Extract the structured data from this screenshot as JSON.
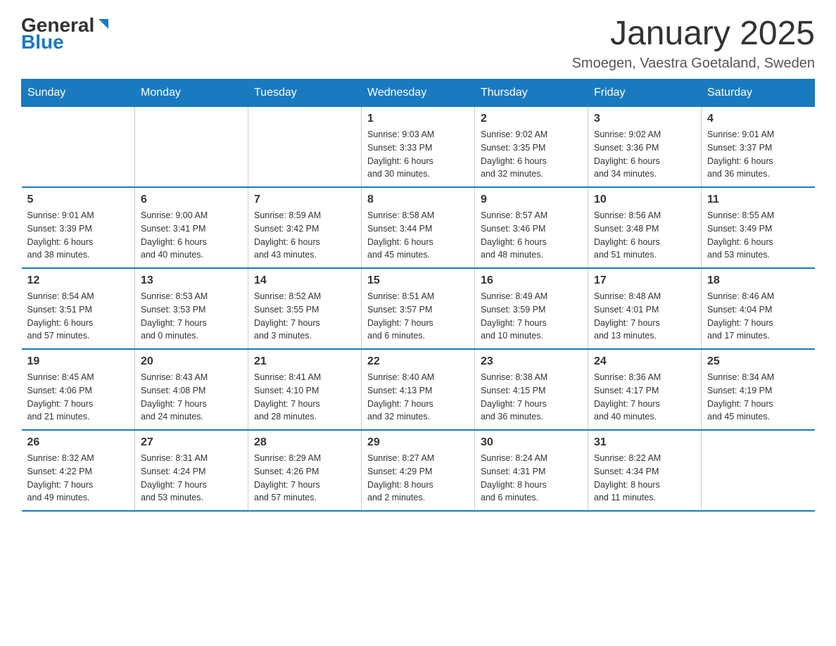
{
  "header": {
    "logo_general": "General",
    "logo_blue": "Blue",
    "month_title": "January 2025",
    "location": "Smoegen, Vaestra Goetaland, Sweden"
  },
  "weekdays": [
    "Sunday",
    "Monday",
    "Tuesday",
    "Wednesday",
    "Thursday",
    "Friday",
    "Saturday"
  ],
  "weeks": [
    [
      {
        "day": "",
        "info": ""
      },
      {
        "day": "",
        "info": ""
      },
      {
        "day": "",
        "info": ""
      },
      {
        "day": "1",
        "info": "Sunrise: 9:03 AM\nSunset: 3:33 PM\nDaylight: 6 hours\nand 30 minutes."
      },
      {
        "day": "2",
        "info": "Sunrise: 9:02 AM\nSunset: 3:35 PM\nDaylight: 6 hours\nand 32 minutes."
      },
      {
        "day": "3",
        "info": "Sunrise: 9:02 AM\nSunset: 3:36 PM\nDaylight: 6 hours\nand 34 minutes."
      },
      {
        "day": "4",
        "info": "Sunrise: 9:01 AM\nSunset: 3:37 PM\nDaylight: 6 hours\nand 36 minutes."
      }
    ],
    [
      {
        "day": "5",
        "info": "Sunrise: 9:01 AM\nSunset: 3:39 PM\nDaylight: 6 hours\nand 38 minutes."
      },
      {
        "day": "6",
        "info": "Sunrise: 9:00 AM\nSunset: 3:41 PM\nDaylight: 6 hours\nand 40 minutes."
      },
      {
        "day": "7",
        "info": "Sunrise: 8:59 AM\nSunset: 3:42 PM\nDaylight: 6 hours\nand 43 minutes."
      },
      {
        "day": "8",
        "info": "Sunrise: 8:58 AM\nSunset: 3:44 PM\nDaylight: 6 hours\nand 45 minutes."
      },
      {
        "day": "9",
        "info": "Sunrise: 8:57 AM\nSunset: 3:46 PM\nDaylight: 6 hours\nand 48 minutes."
      },
      {
        "day": "10",
        "info": "Sunrise: 8:56 AM\nSunset: 3:48 PM\nDaylight: 6 hours\nand 51 minutes."
      },
      {
        "day": "11",
        "info": "Sunrise: 8:55 AM\nSunset: 3:49 PM\nDaylight: 6 hours\nand 53 minutes."
      }
    ],
    [
      {
        "day": "12",
        "info": "Sunrise: 8:54 AM\nSunset: 3:51 PM\nDaylight: 6 hours\nand 57 minutes."
      },
      {
        "day": "13",
        "info": "Sunrise: 8:53 AM\nSunset: 3:53 PM\nDaylight: 7 hours\nand 0 minutes."
      },
      {
        "day": "14",
        "info": "Sunrise: 8:52 AM\nSunset: 3:55 PM\nDaylight: 7 hours\nand 3 minutes."
      },
      {
        "day": "15",
        "info": "Sunrise: 8:51 AM\nSunset: 3:57 PM\nDaylight: 7 hours\nand 6 minutes."
      },
      {
        "day": "16",
        "info": "Sunrise: 8:49 AM\nSunset: 3:59 PM\nDaylight: 7 hours\nand 10 minutes."
      },
      {
        "day": "17",
        "info": "Sunrise: 8:48 AM\nSunset: 4:01 PM\nDaylight: 7 hours\nand 13 minutes."
      },
      {
        "day": "18",
        "info": "Sunrise: 8:46 AM\nSunset: 4:04 PM\nDaylight: 7 hours\nand 17 minutes."
      }
    ],
    [
      {
        "day": "19",
        "info": "Sunrise: 8:45 AM\nSunset: 4:06 PM\nDaylight: 7 hours\nand 21 minutes."
      },
      {
        "day": "20",
        "info": "Sunrise: 8:43 AM\nSunset: 4:08 PM\nDaylight: 7 hours\nand 24 minutes."
      },
      {
        "day": "21",
        "info": "Sunrise: 8:41 AM\nSunset: 4:10 PM\nDaylight: 7 hours\nand 28 minutes."
      },
      {
        "day": "22",
        "info": "Sunrise: 8:40 AM\nSunset: 4:13 PM\nDaylight: 7 hours\nand 32 minutes."
      },
      {
        "day": "23",
        "info": "Sunrise: 8:38 AM\nSunset: 4:15 PM\nDaylight: 7 hours\nand 36 minutes."
      },
      {
        "day": "24",
        "info": "Sunrise: 8:36 AM\nSunset: 4:17 PM\nDaylight: 7 hours\nand 40 minutes."
      },
      {
        "day": "25",
        "info": "Sunrise: 8:34 AM\nSunset: 4:19 PM\nDaylight: 7 hours\nand 45 minutes."
      }
    ],
    [
      {
        "day": "26",
        "info": "Sunrise: 8:32 AM\nSunset: 4:22 PM\nDaylight: 7 hours\nand 49 minutes."
      },
      {
        "day": "27",
        "info": "Sunrise: 8:31 AM\nSunset: 4:24 PM\nDaylight: 7 hours\nand 53 minutes."
      },
      {
        "day": "28",
        "info": "Sunrise: 8:29 AM\nSunset: 4:26 PM\nDaylight: 7 hours\nand 57 minutes."
      },
      {
        "day": "29",
        "info": "Sunrise: 8:27 AM\nSunset: 4:29 PM\nDaylight: 8 hours\nand 2 minutes."
      },
      {
        "day": "30",
        "info": "Sunrise: 8:24 AM\nSunset: 4:31 PM\nDaylight: 8 hours\nand 6 minutes."
      },
      {
        "day": "31",
        "info": "Sunrise: 8:22 AM\nSunset: 4:34 PM\nDaylight: 8 hours\nand 11 minutes."
      },
      {
        "day": "",
        "info": ""
      }
    ]
  ]
}
